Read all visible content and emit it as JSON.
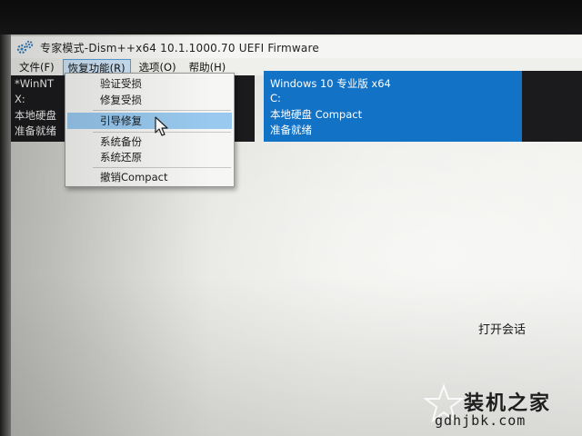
{
  "window": {
    "title": "专家模式-Dism++x64 10.1.1000.70 UEFI Firmware"
  },
  "menubar": {
    "items": [
      "文件(F)",
      "恢复功能(R)",
      "选项(O)",
      "帮助(H)"
    ]
  },
  "recovery_menu": {
    "items": [
      "验证受损",
      "修复受损",
      "引导修复",
      "系统备份",
      "系统还原",
      "撤销Compact"
    ],
    "highlighted": "引导修复"
  },
  "left_panel": {
    "lines": [
      "*WinNT",
      "X:",
      "本地硬盘",
      "准备就绪"
    ]
  },
  "selected_panel": {
    "lines": [
      "Windows 10 专业版 x64",
      "C:",
      "本地硬盘 Compact",
      "准备就绪"
    ]
  },
  "main": {
    "open_session_label": "打开会话"
  },
  "watermark": {
    "title": "装机之家",
    "url": "gdhjbk.com"
  },
  "colors": {
    "selected_panel_bg": "#1272c6",
    "dark_panel_bg": "#1b1b1d",
    "menu_hover": "#99c9ef"
  },
  "icons": {
    "app": "gear-icon",
    "pointer": "mouse-cursor-icon",
    "watermark": "star-logo-icon"
  }
}
